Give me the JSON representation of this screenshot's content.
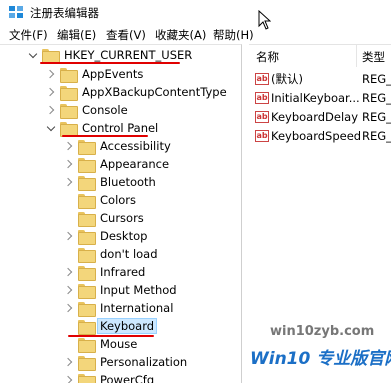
{
  "window": {
    "title": "注册表编辑器"
  },
  "menu": [
    "文件(F)",
    "编辑(E)",
    "查看(V)",
    "收藏夹(A)",
    "帮助(H)"
  ],
  "tree": {
    "root": "HKEY_CURRENT_USER",
    "items": [
      "AppEvents",
      "AppXBackupContentType",
      "Console",
      "Control Panel",
      "Accessibility",
      "Appearance",
      "Bluetooth",
      "Colors",
      "Cursors",
      "Desktop",
      "don't load",
      "Infrared",
      "Input Method",
      "International",
      "Keyboard",
      "Mouse",
      "Personalization",
      "PowerCfg"
    ],
    "selected": "Keyboard"
  },
  "values": {
    "headers": {
      "name": "名称",
      "type": "类型"
    },
    "rows": [
      {
        "name": "(默认)",
        "type": "REG_"
      },
      {
        "name": "InitialKeyboar...",
        "type": "REG_"
      },
      {
        "name": "KeyboardDelay",
        "type": "REG_"
      },
      {
        "name": "KeyboardSpeed",
        "type": "REG_"
      }
    ]
  },
  "watermark": {
    "url": "win10zyb.com",
    "text": "Win10 专业版官网"
  },
  "annotation_color": "#e00000",
  "selection_color": "#cce8ff"
}
